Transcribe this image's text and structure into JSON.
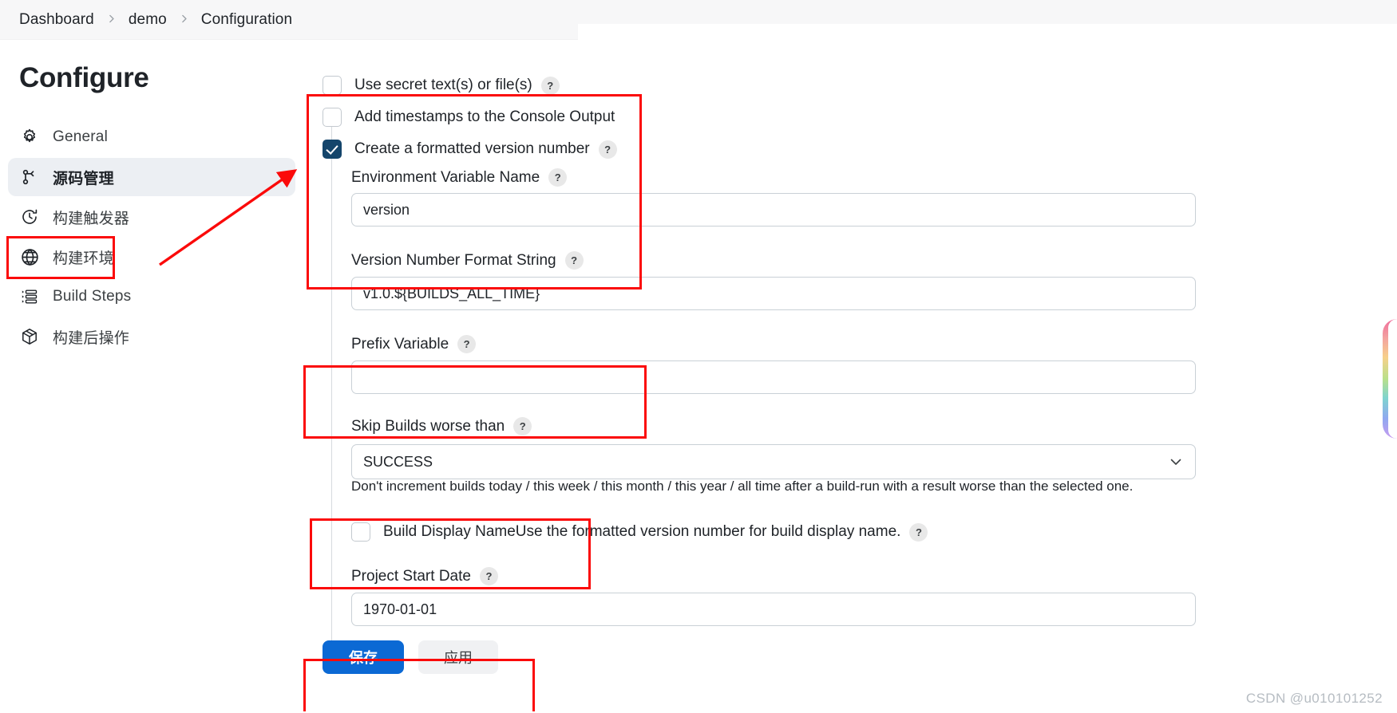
{
  "breadcrumb": {
    "items": [
      "Dashboard",
      "demo",
      "Configuration"
    ]
  },
  "sidebar": {
    "title": "Configure",
    "items": [
      {
        "label": "General",
        "icon": "gear-icon",
        "active": false
      },
      {
        "label": "源码管理",
        "icon": "source-branch-icon",
        "active": true
      },
      {
        "label": "构建触发器",
        "icon": "clock-icon",
        "active": false
      },
      {
        "label": "构建环境",
        "icon": "globe-icon",
        "active": false
      },
      {
        "label": "Build Steps",
        "icon": "list-steps-icon",
        "active": false
      },
      {
        "label": "构建后操作",
        "icon": "package-icon",
        "active": false
      }
    ]
  },
  "main": {
    "checkbox_secret_text": "Use secret text(s) or file(s)",
    "checkbox_timestamps": "Add timestamps to the Console Output",
    "checkbox_version_number": "Create a formatted version number",
    "env_var_label": "Environment Variable Name",
    "env_var_value": "version",
    "format_string_label": "Version Number Format String",
    "format_string_value": "v1.0.${BUILDS_ALL_TIME}",
    "prefix_variable_label": "Prefix Variable",
    "prefix_variable_value": "",
    "skip_builds_label": "Skip Builds worse than",
    "skip_builds_value": "SUCCESS",
    "skip_builds_hint": "Don't increment builds today / this week / this month / this year / all time after a build-run with a result worse than the selected one.",
    "build_display_name_label": "Build Display NameUse the formatted version number for build display name.",
    "project_start_date_label": "Project Start Date",
    "project_start_date_value": "1970-01-01",
    "help_badge": "?"
  },
  "footer": {
    "save_button": "保存",
    "apply_button": "应用"
  },
  "watermark": "CSDN @u010101252",
  "colors": {
    "accent_blue": "#0b69d4",
    "checkbox_checked": "#14456b",
    "annotation_red": "#fb0a0a",
    "sidebar_active_bg": "#eceff3"
  }
}
